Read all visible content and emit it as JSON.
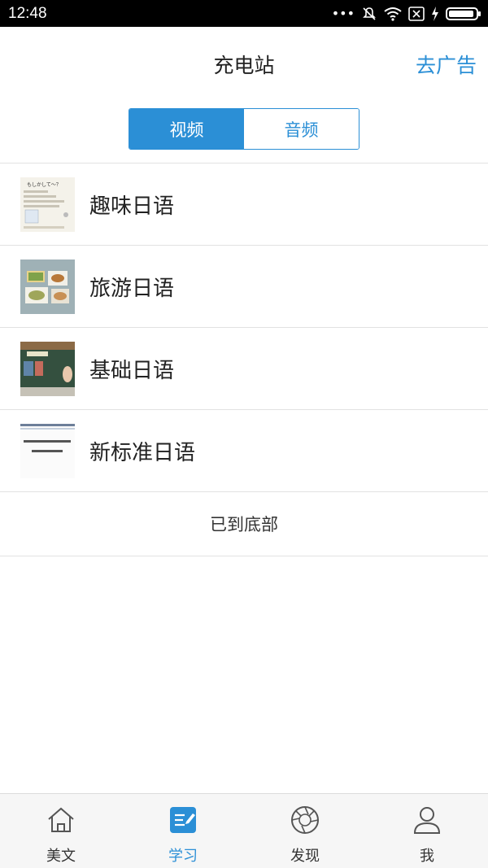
{
  "status_bar": {
    "time": "12:48"
  },
  "header": {
    "title": "充电站",
    "action": "去广告"
  },
  "tabs": [
    {
      "label": "视频",
      "active": true
    },
    {
      "label": "音频",
      "active": false
    }
  ],
  "list": [
    {
      "label": "趣味日语",
      "thumb_text": "もしかして～？"
    },
    {
      "label": "旅游日语"
    },
    {
      "label": "基础日语"
    },
    {
      "label": "新标准日语"
    }
  ],
  "footer_note": "已到底部",
  "bottom_nav": [
    {
      "label": "美文",
      "icon": "home-icon",
      "active": false
    },
    {
      "label": "学习",
      "icon": "study-icon",
      "active": true
    },
    {
      "label": "发现",
      "icon": "discover-icon",
      "active": false
    },
    {
      "label": "我",
      "icon": "profile-icon",
      "active": false
    }
  ],
  "colors": {
    "accent": "#2b8fd6",
    "background": "#ffffff",
    "nav_bg": "#f6f6f6"
  }
}
